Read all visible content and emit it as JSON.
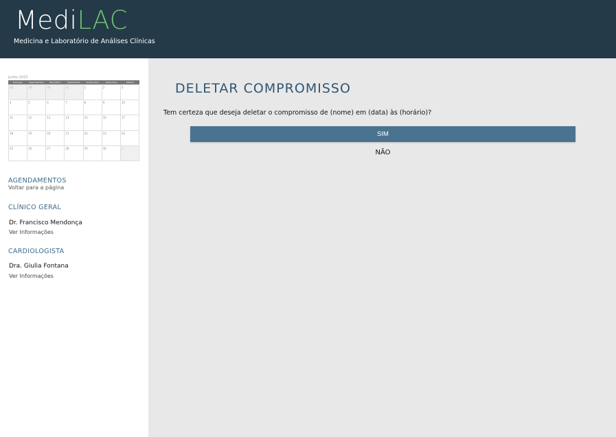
{
  "header": {
    "logo_medi": "Medi",
    "logo_lac": "LAC",
    "tagline": "Medicina e Laboratório de Análises Clínicas"
  },
  "calendar": {
    "title": "Junho 2023",
    "weekdays": [
      "Domingo",
      "Segunda-Feira",
      "Terça-Feira",
      "Quarta-Feira",
      "Quinta-Feira",
      "Sexta-Feira",
      "Sábado"
    ],
    "weeks": [
      [
        "28",
        "29",
        "30",
        "31",
        "1",
        "2",
        "3"
      ],
      [
        "4",
        "5",
        "6",
        "7",
        "8",
        "9",
        "10"
      ],
      [
        "11",
        "12",
        "13",
        "14",
        "15",
        "16",
        "17"
      ],
      [
        "18",
        "19",
        "20",
        "21",
        "22",
        "23",
        "24"
      ],
      [
        "25",
        "26",
        "27",
        "28",
        "29",
        "30",
        "1"
      ]
    ]
  },
  "sidebar": {
    "agendamentos_title": "AGENDAMENTOS",
    "agendamentos_link": "Voltar para a página",
    "clinico_title": "CLÍNICO GERAL",
    "clinico_doctor": "Dr. Francisco Mendonça",
    "clinico_link": "Ver Informações",
    "cardio_title": "CARDIOLOGISTA",
    "cardio_doctor": "Dra. Giulia Fontana",
    "cardio_link": "Ver Informações"
  },
  "main": {
    "title": "DELETAR COMPROMISSO",
    "question": "Tem certeza que deseja deletar o compromisso de (nome) em (data) às (horário)?",
    "yes_label": "SIM",
    "no_label": "NÃO"
  },
  "colors": {
    "header_bg": "#243a48",
    "logo_accent": "#6fbf73",
    "title": "#2e5673",
    "button": "#4a7390",
    "content_bg": "#e8e8e8"
  }
}
